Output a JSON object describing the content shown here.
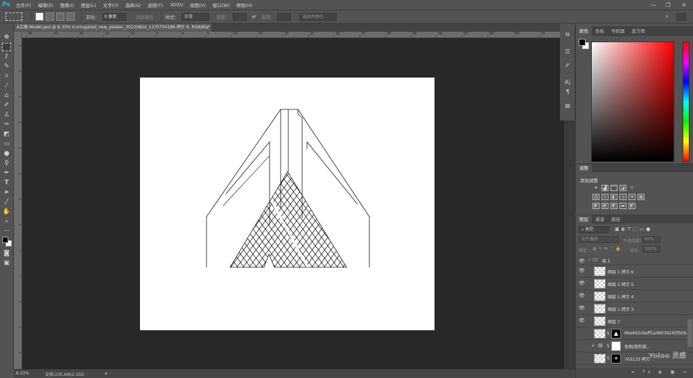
{
  "app": {
    "logo": "Ps",
    "menu": [
      "文件(F)",
      "编辑(E)",
      "图像(I)",
      "图层(L)",
      "文字(Y)",
      "选择(S)",
      "滤镜(T)",
      "3D(D)",
      "视图(V)",
      "窗口(W)",
      "帮助(H)"
    ],
    "window_controls": {
      "minimize": "—",
      "restore": "❐",
      "close": "✕"
    }
  },
  "options": {
    "feather_label": "羽化：",
    "feather_value": "0 像素",
    "antialias_label": "消除锯齿",
    "style_label": "样式：",
    "style_value": "正常",
    "width_label": "宽度：",
    "height_label": "高度：",
    "select_mask_label": "选择并遮住..."
  },
  "document": {
    "tab_title": "A立面-Model.psd @ 8.33% (corrugated_new_plaster_20120824_1375704186 拷贝 6, RGB/8) *",
    "tab_close": "×"
  },
  "ruler": {
    "labels": [
      "30",
      "25",
      "20",
      "15",
      "10",
      "5",
      "0",
      "5",
      "10",
      "15",
      "20",
      "25",
      "30",
      "35",
      "40",
      "45",
      "50",
      "55",
      "60",
      "65",
      "70"
    ]
  },
  "status": {
    "zoom": "8.33%",
    "doc_info": "文档:235.6M/2.35G",
    "arrow": "▸"
  },
  "color_panel": {
    "tabs": [
      "颜色",
      "色板",
      "导航器",
      "直方图"
    ],
    "active_tab": "颜色",
    "hue_color": "#ff0000"
  },
  "adjustments_panel": {
    "tab": "调整",
    "add_label": "添加调整"
  },
  "layers_panel": {
    "tabs": [
      "图层",
      "通道",
      "路径"
    ],
    "active_tab": "图层",
    "filter_kind": "类型",
    "blend_mode": "正片叠底",
    "opacity_label": "不透明度：",
    "opacity_value": "40%",
    "lock_label": "锁定：",
    "fill_label": "填充：",
    "fill_value": "100%",
    "layers": [
      {
        "name": "组 1",
        "kind": "group",
        "visible": true
      },
      {
        "name": "图层 1 拷贝 6",
        "kind": "layer",
        "visible": true
      },
      {
        "name": "图层 1 拷贝 5",
        "kind": "layer",
        "visible": true
      },
      {
        "name": "图层 1 拷贝 4",
        "kind": "layer",
        "visible": true
      },
      {
        "name": "图层 1 拷贝 3",
        "kind": "layer",
        "visible": true
      },
      {
        "name": "图层 7",
        "kind": "layer",
        "visible": true
      },
      {
        "name": "66e642cbaff1a46036245f92b...",
        "kind": "smart",
        "visible": false
      },
      {
        "name": "色相/饱和度...",
        "kind": "adjustment",
        "visible": false
      },
      {
        "name": "763133 拷贝",
        "kind": "layer",
        "visible": false
      }
    ]
  },
  "watermark": "Yoloo 灵感"
}
